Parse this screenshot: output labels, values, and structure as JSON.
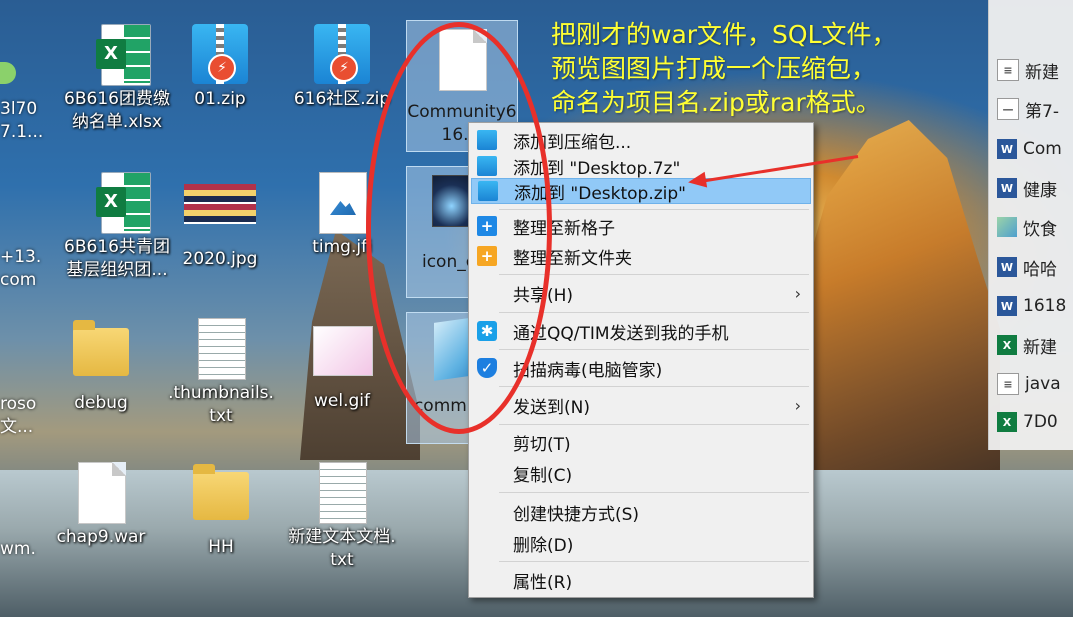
{
  "annotation": {
    "lines": [
      "把刚才的war文件，SQL文件，",
      "预览图图片打成一个压缩包，",
      "命名为项目名.zip或rar格式。"
    ],
    "color": "#ffff33",
    "highlight_color": "#e8302a"
  },
  "desktop_icons": [
    {
      "label": "6B616团费缴纳名单.xlsx",
      "icon": "excel-file-icon"
    },
    {
      "label": "01.zip",
      "icon": "zip-archive-icon"
    },
    {
      "label": "616社区.zip",
      "icon": "zip-archive-icon"
    },
    {
      "label": "Community616.w",
      "icon": "blank-file-icon"
    },
    {
      "label": "6B616共青团基层组织团...",
      "icon": "excel-file-icon"
    },
    {
      "label": "2020.jpg",
      "icon": "image-file-icon"
    },
    {
      "label": "timg.jfi",
      "icon": "image-file-icon"
    },
    {
      "label": "icon_c ng",
      "icon": "image-file-icon"
    },
    {
      "label": "debug",
      "icon": "folder-icon"
    },
    {
      "label": ".thumbnails.txt",
      "icon": "text-file-icon"
    },
    {
      "label": "wel.gif",
      "icon": "gif-file-icon"
    },
    {
      "label": "commu 16.",
      "icon": "notepad-file-icon"
    },
    {
      "label": "chap9.war",
      "icon": "blank-file-icon"
    },
    {
      "label": "HH",
      "icon": "folder-icon"
    },
    {
      "label": "新建文本文档.txt",
      "icon": "text-file-icon"
    }
  ],
  "left_edge_labels": [
    "3l70",
    "7.1...",
    "+13.",
    "com",
    "roso",
    "文...",
    "wm."
  ],
  "right_panel": {
    "items": [
      {
        "label": "新建",
        "icon": "doc-icon"
      },
      {
        "label": "第7-",
        "icon": "doc-icon"
      },
      {
        "label": "Com",
        "icon": "word-icon"
      },
      {
        "label": "健康",
        "icon": "word-icon"
      },
      {
        "label": "饮食",
        "icon": "image-icon"
      },
      {
        "label": "哈哈",
        "icon": "word-icon"
      },
      {
        "label": "1618",
        "icon": "word-icon"
      },
      {
        "label": "新建",
        "icon": "excel-icon"
      },
      {
        "label": "java",
        "icon": "doc-icon"
      },
      {
        "label": "7D0",
        "icon": "excel-icon"
      }
    ]
  },
  "context_menu": {
    "items": [
      {
        "label": "添加到压缩包...",
        "icon": "zip-icon"
      },
      {
        "label": "添加到 \"Desktop.7z\"",
        "icon": "zip-icon"
      },
      {
        "label": "添加到 \"Desktop.zip\"",
        "icon": "zip-icon",
        "highlighted": true
      },
      {
        "label": "整理至新格子",
        "icon": "plus-icon"
      },
      {
        "label": "整理至新文件夹",
        "icon": "plus-icon"
      },
      {
        "label": "共享(H)",
        "submenu": true
      },
      {
        "label": "通过QQ/TIM发送到我的手机",
        "icon": "qq-icon"
      },
      {
        "label": "扫描病毒(电脑管家)",
        "icon": "shield-icon"
      },
      {
        "label": "发送到(N)",
        "submenu": true
      },
      {
        "label": "剪切(T)"
      },
      {
        "label": "复制(C)"
      },
      {
        "label": "创建快捷方式(S)"
      },
      {
        "label": "删除(D)"
      },
      {
        "label": "属性(R)"
      }
    ],
    "submenu_glyph": "›"
  }
}
